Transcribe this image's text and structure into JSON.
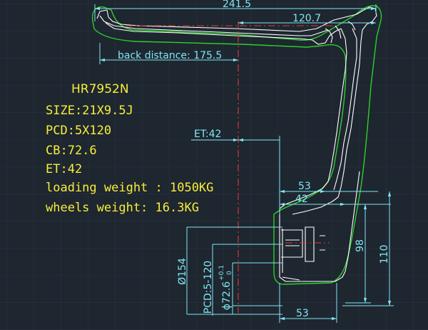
{
  "colors": {
    "background": "#1e2630",
    "grid": "#2b3440",
    "profile_outline": "#ffffff",
    "envelope_outline": "#2bd12b",
    "dimension": "#7fe6f2",
    "center_line": "#e03a2e",
    "spec_text": "#f7ee3a"
  },
  "specs": {
    "model": "HR7952N",
    "size": "SIZE:21X9.5J",
    "pcd": "PCD:5X120",
    "cb": "CB:72.6",
    "et": "ET:42",
    "loading_weight": "loading weight : 1050KG",
    "wheels_weight": "wheels weight: 16.3KG"
  },
  "dimensions": {
    "overall_width": "241.5",
    "inner_width": "120.7",
    "back_distance": "back distance: 175.5",
    "et": "ET:42",
    "hub_53_top": "53",
    "hub_42": "42",
    "hub_53_bottom": "53",
    "height_98": "98",
    "height_110": "110",
    "bolt_circle": "Ø154",
    "pcd_vertical": "PCD:5-120",
    "bore_diameter": "ɸ72.6",
    "bore_tolerance_upper": "+0.1",
    "bore_tolerance_lower": "0"
  }
}
